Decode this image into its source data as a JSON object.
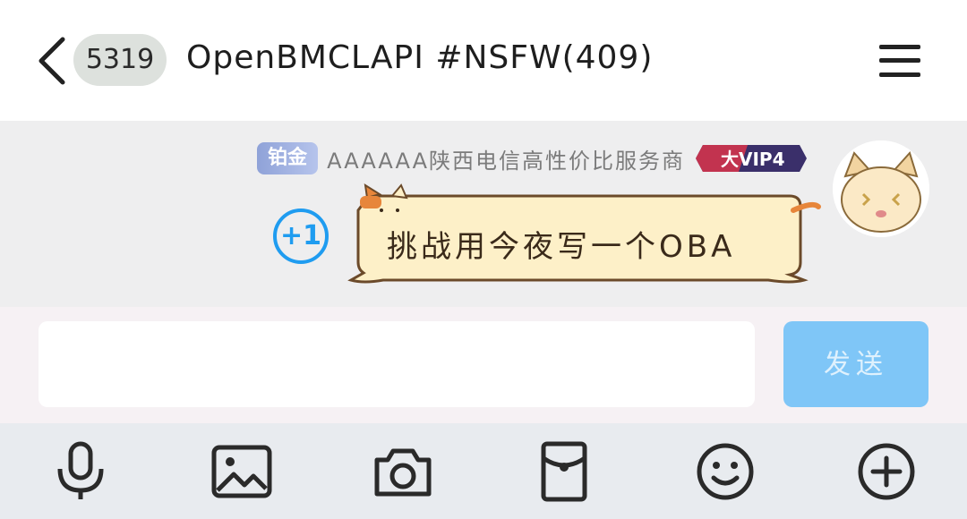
{
  "header": {
    "unread_count": "5319",
    "group_title": "OpenBMCLAPI #NSFW(409)"
  },
  "message": {
    "sender_level": "铂金",
    "sender_name": "AAAAAA陕西电信高性价比服务商",
    "vip_label": "大VIP4",
    "text": "挑战用今夜写一个OBA",
    "plus_one_label": "+1"
  },
  "composer": {
    "input_value": "",
    "send_label": "发送"
  },
  "toolbar": {
    "icons": [
      "microphone-icon",
      "image-icon",
      "camera-icon",
      "red-packet-icon",
      "emoji-icon",
      "add-icon"
    ]
  },
  "colors": {
    "accent_blue": "#1f9cf0",
    "send_button": "#7fc6f7",
    "bubble_fill": "#fdf0c8",
    "bubble_stroke": "#6b4a2a"
  }
}
